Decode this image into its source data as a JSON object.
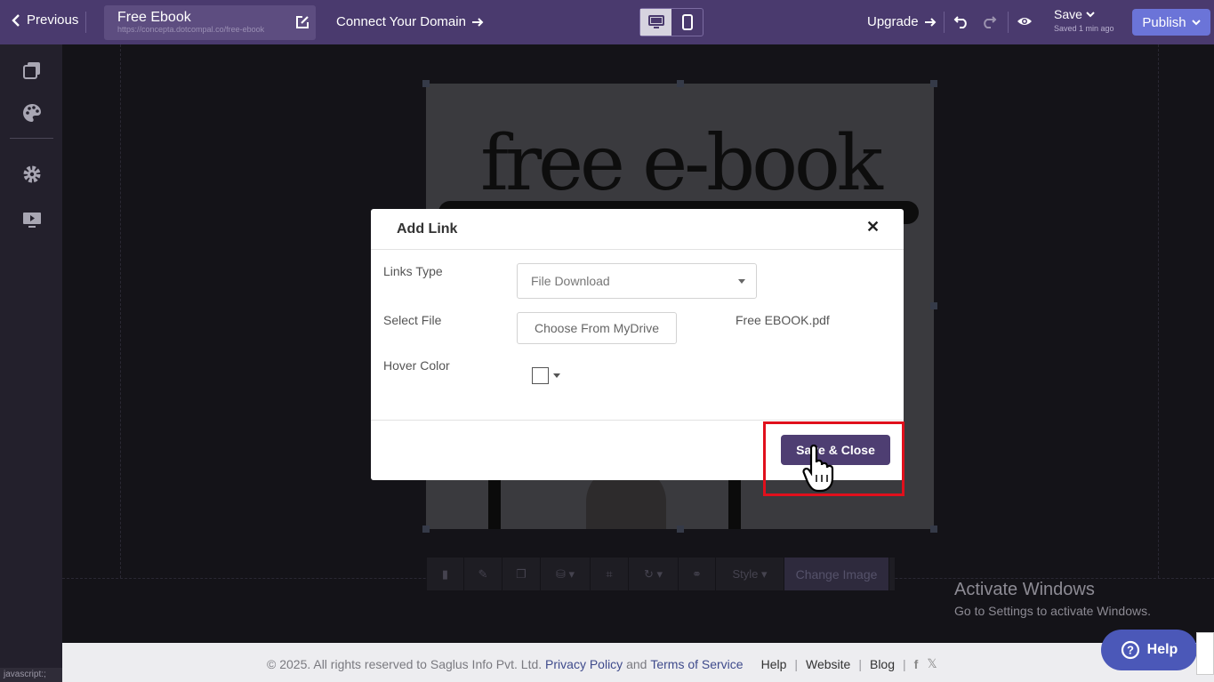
{
  "topbar": {
    "previous_label": "Previous",
    "page_title": "Free Ebook",
    "page_url": "https://concepta.dotcompal.co/free-ebook",
    "connect_domain_label": "Connect Your Domain",
    "upgrade_label": "Upgrade",
    "save_label": "Save",
    "saved_time": "Saved 1 min ago",
    "publish_label": "Publish",
    "device_modes": [
      "desktop-icon",
      "mobile-icon"
    ],
    "active_device": "desktop"
  },
  "sidebar": {
    "items": [
      "pages-icon",
      "palette-icon",
      "gear-icon",
      "preview-icon"
    ],
    "status_text": "javascript:;"
  },
  "canvas": {
    "image_heading": "free e-book",
    "image_toolbar": {
      "items": [
        "trash-icon",
        "edit-icon",
        "duplicate-icon",
        "layers-icon",
        "crop-icon",
        "rotate-icon",
        "link-icon"
      ],
      "style_label": "Style",
      "change_image_label": "Change Image"
    }
  },
  "modal": {
    "title": "Add Link",
    "links_type_label": "Links Type",
    "links_type_value": "File Download",
    "select_file_label": "Select File",
    "choose_button_label": "Choose From MyDrive",
    "file_name": "Free EBOOK.pdf",
    "hover_color_label": "Hover Color",
    "hover_color_value": "#ffffff",
    "save_close_label": "Save & Close"
  },
  "watermark": {
    "title": "Activate Windows",
    "subtitle": "Go to Settings to activate Windows."
  },
  "footer": {
    "copyright": "©  2025. All rights reserved to Saglus Info Pvt. Ltd.",
    "privacy_label": "Privacy Policy",
    "and_text": "and",
    "terms_label": "Terms of Service",
    "help_label": "Help",
    "website_label": "Website",
    "blog_label": "Blog",
    "social": [
      "facebook-icon",
      "x-icon"
    ]
  },
  "help_button": {
    "label": "Help"
  },
  "colors": {
    "topbar": "#4a3a6e",
    "accent_purple": "#4e3e72",
    "publish": "#6b74d8",
    "highlight": "#e0101c"
  }
}
